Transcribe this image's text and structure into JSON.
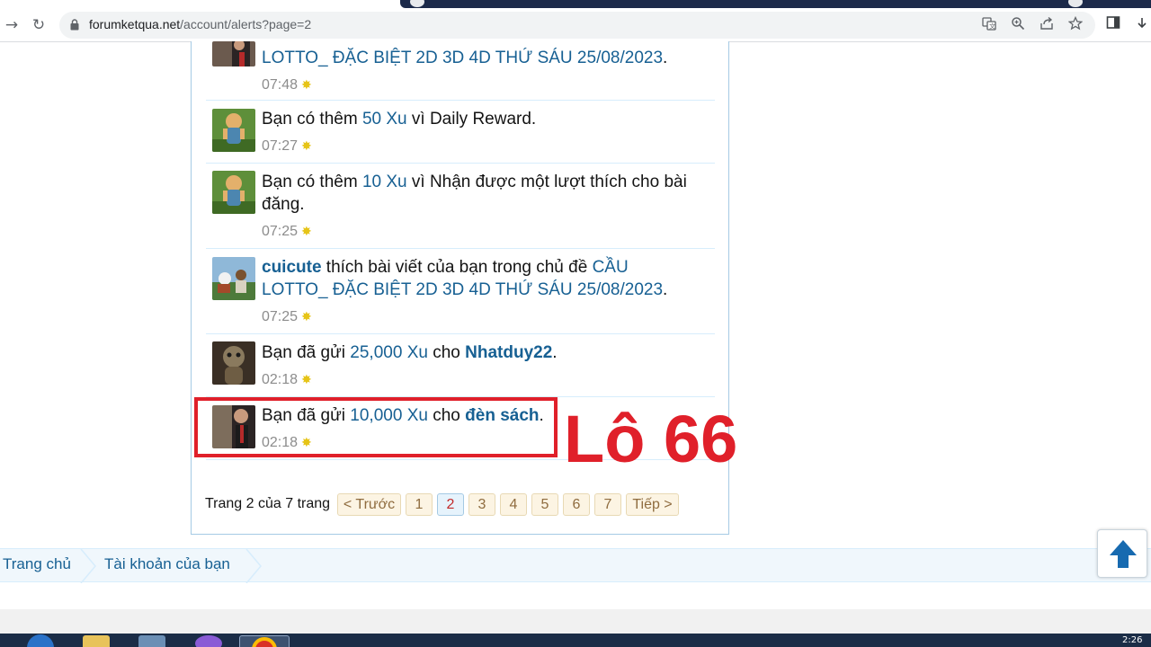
{
  "browser": {
    "url_host": "forumketqua.net",
    "url_path": "/account/alerts?page=2",
    "icons": [
      "back-icon",
      "reload-icon",
      "lock-icon",
      "translate-icon",
      "zoom-icon",
      "share-icon",
      "bookmark-star-icon",
      "sidepanel-icon"
    ]
  },
  "alerts": [
    {
      "pre": "",
      "link": "LOTTO_ ĐẶC BIỆT 2D 3D 4D THỨ SÁU 25/08/2023",
      "post": ".",
      "time": "07:48"
    },
    {
      "pre": "Bạn có thêm ",
      "link": "50 Xu",
      "post": " vì Daily Reward.",
      "time": "07:27"
    },
    {
      "pre": "Bạn có thêm ",
      "link": "10 Xu",
      "post": " vì Nhận được một lượt thích cho bài đăng.",
      "time": "07:25"
    },
    {
      "user": "cuicute",
      "pre": " thích bài viết của bạn trong chủ đề ",
      "link": "CẦU LOTTO_ ĐẶC BIỆT 2D 3D 4D THỨ SÁU 25/08/2023",
      "post": ".",
      "time": "07:25"
    },
    {
      "pre": "Bạn đã gửi ",
      "link": "25,000 Xu",
      "mid": " cho ",
      "user": "Nhatduy22",
      "post": ".",
      "time": "02:18"
    },
    {
      "pre": "Bạn đã gửi ",
      "link": "10,000 Xu",
      "mid": " cho ",
      "user": "đèn sách",
      "post": ".",
      "time": "02:18"
    }
  ],
  "annotation": "Lô 66",
  "pager": {
    "label": "Trang 2 của 7 trang",
    "prev": "< Trước",
    "pages": [
      "1",
      "2",
      "3",
      "4",
      "5",
      "6",
      "7"
    ],
    "current": "2",
    "next": "Tiếp >"
  },
  "breadcrumb": [
    "Trang chủ",
    "Tài khoản của bạn"
  ],
  "taskbar": {
    "clock": "2:26"
  },
  "colors": {
    "link": "#176093",
    "highlight": "#e0202a"
  }
}
